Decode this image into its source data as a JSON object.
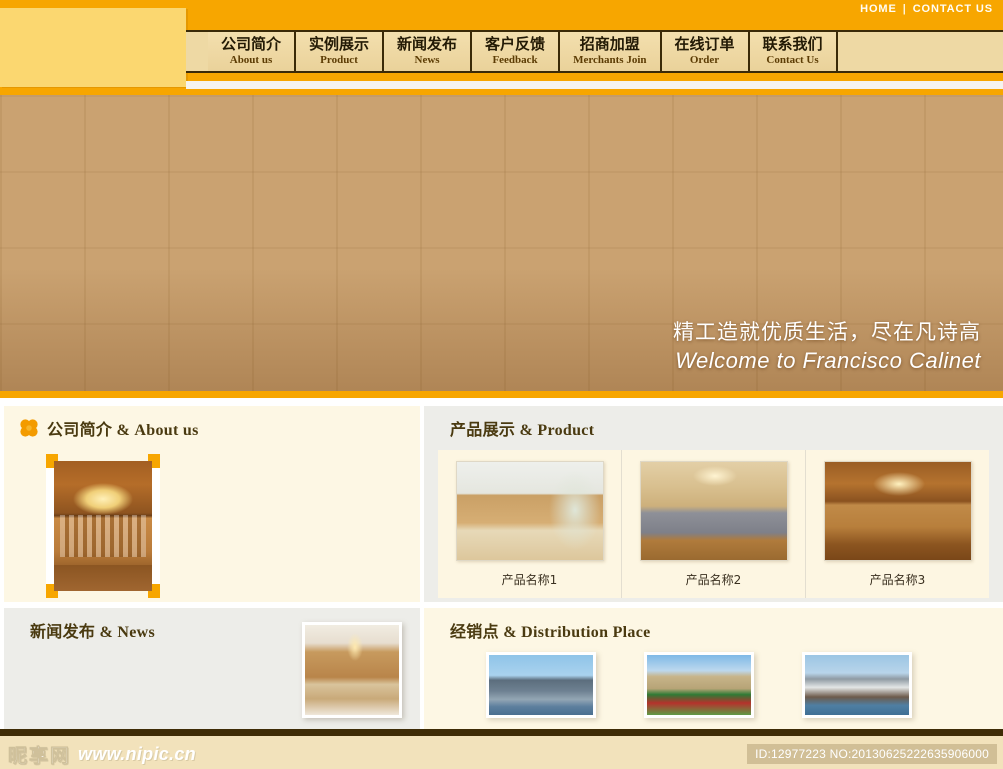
{
  "header": {
    "top_links": [
      {
        "label": "HOME"
      },
      {
        "label": "CONTACT US"
      }
    ],
    "separator": "|",
    "nav": [
      {
        "cn": "公司简介",
        "en": "About us"
      },
      {
        "cn": "实例展示",
        "en": "Product"
      },
      {
        "cn": "新闻发布",
        "en": "News"
      },
      {
        "cn": "客户反馈",
        "en": "Feedback"
      },
      {
        "cn": "招商加盟",
        "en": "Merchants Join"
      },
      {
        "cn": "在线订单",
        "en": "Order"
      },
      {
        "cn": "联系我们",
        "en": "Contact Us"
      }
    ],
    "accent_color": "#F7A600",
    "logo_panel_color": "#FBD770",
    "nav_bg_color": "#EED9A4"
  },
  "hero": {
    "slogan_cn": "精工造就优质生活，尽在凡诗高",
    "slogan_en": "Welcome to Francisco Calinet",
    "alt": "kitchen-interior-photo"
  },
  "sections": {
    "about": {
      "title": "公司简介 & About us",
      "icon": "flower-icon",
      "photo_alt": "wooden-showroom-photo"
    },
    "product": {
      "title": "产品展示 & Product",
      "items": [
        {
          "label": "产品名称1",
          "alt": "bathroom-vanity-photo"
        },
        {
          "label": "产品名称2",
          "alt": "kitchen-island-photo"
        },
        {
          "label": "产品名称3",
          "alt": "wooden-library-photo"
        }
      ]
    },
    "news": {
      "title": "新闻发布 & News",
      "photo_alt": "kitchen-bar-photo"
    },
    "distribution": {
      "title": "经销点 & Distribution Place",
      "items": [
        {
          "alt": "hong-kong-skyline-photo"
        },
        {
          "alt": "european-castle-photo"
        },
        {
          "alt": "sydney-opera-house-photo"
        }
      ]
    }
  },
  "footer": {
    "watermark_cn": "昵享网",
    "watermark_url": "www.nipic.cn",
    "id_text": "ID:12977223 NO:20130625222635906000",
    "bar_color": "#F2E2BB",
    "top_border_color": "#3F2C06"
  }
}
